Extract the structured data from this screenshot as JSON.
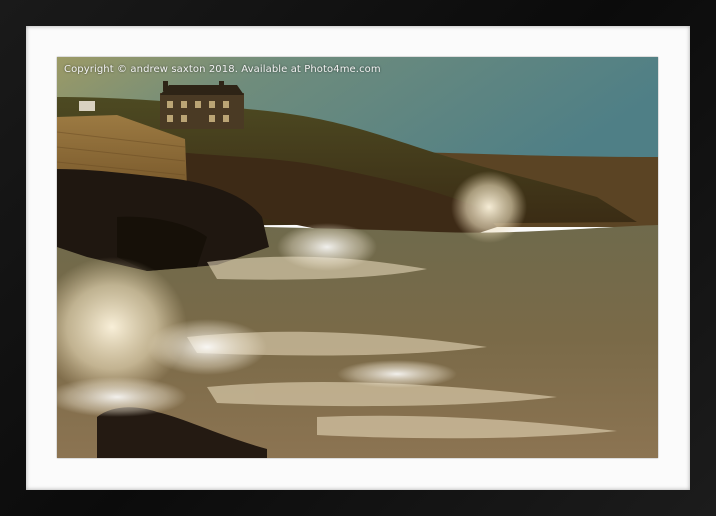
{
  "watermark": {
    "text": "Copyright  © andrew saxton  2018. Available at Photo4me.com"
  },
  "colors": {
    "frame": "#111111",
    "mount": "#fbfbfb",
    "sky": "#5f8a88",
    "sea_foam": "#efe3c8",
    "cliff": "#3a2a1a"
  }
}
